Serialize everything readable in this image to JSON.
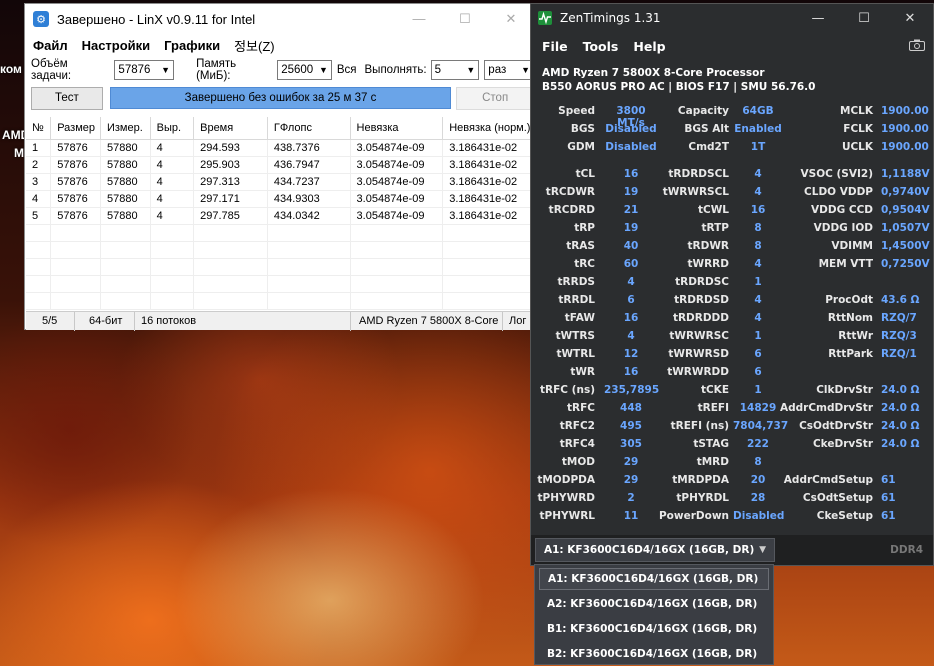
{
  "desktop": {
    "icon_text_1": "ком",
    "icon_text_2": "AMD",
    "icon_text_3": "M"
  },
  "linx": {
    "title": "Завершено - LinX v0.9.11 for Intel",
    "window_buttons": {
      "minimize": "—",
      "maximize": "☐",
      "close": "✕"
    },
    "menu": [
      "Файл",
      "Настройки",
      "Графики",
      "정보(Z)"
    ],
    "params": {
      "size_label": "Объём задачи:",
      "size_value": "57876",
      "memory_label": "Память (МиБ):",
      "memory_value": "25600",
      "all_label": "Вся",
      "run_label": "Выполнять:",
      "run_value": "5",
      "unit_value": "раз"
    },
    "test_button": "Тест",
    "progress_text": "Завершено без ошибок за 25 м 37 с",
    "stop_button": "Стоп",
    "columns": [
      "№",
      "Размер",
      "Измер.",
      "Выр.",
      "Время",
      "ГФлопс",
      "Невязка",
      "Невязка (норм.)"
    ],
    "rows": [
      [
        "1",
        "57876",
        "57880",
        "4",
        "294.593",
        "438.7376",
        "3.054874e-09",
        "3.186431e-02"
      ],
      [
        "2",
        "57876",
        "57880",
        "4",
        "295.903",
        "436.7947",
        "3.054874e-09",
        "3.186431e-02"
      ],
      [
        "3",
        "57876",
        "57880",
        "4",
        "297.313",
        "434.7237",
        "3.054874e-09",
        "3.186431e-02"
      ],
      [
        "4",
        "57876",
        "57880",
        "4",
        "297.171",
        "434.9303",
        "3.054874e-09",
        "3.186431e-02"
      ],
      [
        "5",
        "57876",
        "57880",
        "4",
        "297.785",
        "434.0342",
        "3.054874e-09",
        "3.186431e-02"
      ]
    ],
    "status": {
      "progress": "5/5",
      "bits": "64-бит",
      "threads": "16 потоков",
      "cpu": "AMD Ryzen 7 5800X 8-Core",
      "log": "Лог"
    }
  },
  "zen": {
    "title": "ZenTimings 1.31",
    "window_buttons": {
      "minimize": "—",
      "maximize": "☐",
      "close": "✕"
    },
    "menu": [
      "File",
      "Tools",
      "Help"
    ],
    "processor": "AMD Ryzen 7 5800X 8-Core Processor",
    "board": "B550 AORUS PRO AC | BIOS F17 | SMU 56.76.0",
    "timings": [
      [
        [
          "Speed",
          "3800 MT/s"
        ],
        [
          "Capacity",
          "64GB"
        ],
        [
          "MCLK",
          "1900.00"
        ]
      ],
      [
        [
          "BGS",
          "Disabled"
        ],
        [
          "BGS Alt",
          "Enabled"
        ],
        [
          "FCLK",
          "1900.00"
        ]
      ],
      [
        [
          "GDM",
          "Disabled"
        ],
        [
          "Cmd2T",
          "1T"
        ],
        [
          "UCLK",
          "1900.00"
        ]
      ],
      [
        [
          "tCL",
          "16"
        ],
        [
          "tRDRDSCL",
          "4"
        ],
        [
          "VSOC (SVI2)",
          "1,1188V"
        ]
      ],
      [
        [
          "tRCDWR",
          "19"
        ],
        [
          "tWRWRSCL",
          "4"
        ],
        [
          "CLDO VDDP",
          "0,9740V"
        ]
      ],
      [
        [
          "tRCDRD",
          "21"
        ],
        [
          "tCWL",
          "16"
        ],
        [
          "VDDG CCD",
          "0,9504V"
        ]
      ],
      [
        [
          "tRP",
          "19"
        ],
        [
          "tRTP",
          "8"
        ],
        [
          "VDDG IOD",
          "1,0507V"
        ]
      ],
      [
        [
          "tRAS",
          "40"
        ],
        [
          "tRDWR",
          "8"
        ],
        [
          "VDIMM",
          "1,4500V"
        ]
      ],
      [
        [
          "tRC",
          "60"
        ],
        [
          "tWRRD",
          "4"
        ],
        [
          "MEM VTT",
          "0,7250V"
        ]
      ],
      [
        [
          "tRRDS",
          "4"
        ],
        [
          "tRDRDSC",
          "1"
        ],
        [
          "",
          ""
        ]
      ],
      [
        [
          "tRRDL",
          "6"
        ],
        [
          "tRDRDSD",
          "4"
        ],
        [
          "ProcOdt",
          "43.6 Ω"
        ]
      ],
      [
        [
          "tFAW",
          "16"
        ],
        [
          "tRDRDDD",
          "4"
        ],
        [
          "RttNom",
          "RZQ/7"
        ]
      ],
      [
        [
          "tWTRS",
          "4"
        ],
        [
          "tWRWRSC",
          "1"
        ],
        [
          "RttWr",
          "RZQ/3"
        ]
      ],
      [
        [
          "tWTRL",
          "12"
        ],
        [
          "tWRWRSD",
          "6"
        ],
        [
          "RttPark",
          "RZQ/1"
        ]
      ],
      [
        [
          "tWR",
          "16"
        ],
        [
          "tWRWRDD",
          "6"
        ],
        [
          "",
          ""
        ]
      ],
      [
        [
          "tRFC (ns)",
          "235,7895"
        ],
        [
          "tCKE",
          "1"
        ],
        [
          "ClkDrvStr",
          "24.0 Ω"
        ]
      ],
      [
        [
          "tRFC",
          "448"
        ],
        [
          "tREFI",
          "14829"
        ],
        [
          "AddrCmdDrvStr",
          "24.0 Ω"
        ]
      ],
      [
        [
          "tRFC2",
          "495"
        ],
        [
          "tREFI (ns)",
          "7804,737"
        ],
        [
          "CsOdtDrvStr",
          "24.0 Ω"
        ]
      ],
      [
        [
          "tRFC4",
          "305"
        ],
        [
          "tSTAG",
          "222"
        ],
        [
          "CkeDrvStr",
          "24.0 Ω"
        ]
      ],
      [
        [
          "tMOD",
          "29"
        ],
        [
          "tMRD",
          "8"
        ],
        [
          "",
          ""
        ]
      ],
      [
        [
          "tMODPDA",
          "29"
        ],
        [
          "tMRDPDA",
          "20"
        ],
        [
          "AddrCmdSetup",
          "61"
        ]
      ],
      [
        [
          "tPHYWRD",
          "2"
        ],
        [
          "tPHYRDL",
          "28"
        ],
        [
          "CsOdtSetup",
          "61"
        ]
      ],
      [
        [
          "tPHYWRL",
          "11"
        ],
        [
          "PowerDown",
          "Disabled"
        ],
        [
          "CkeSetup",
          "61"
        ]
      ]
    ],
    "selected_module": "A1: KF3600C16D4/16GX (16GB, DR)",
    "memory_type": "DDR4",
    "module_options": [
      "A1: KF3600C16D4/16GX (16GB, DR)",
      "A2: KF3600C16D4/16GX (16GB, DR)",
      "B1: KF3600C16D4/16GX (16GB, DR)",
      "B2: KF3600C16D4/16GX (16GB, DR)"
    ]
  }
}
